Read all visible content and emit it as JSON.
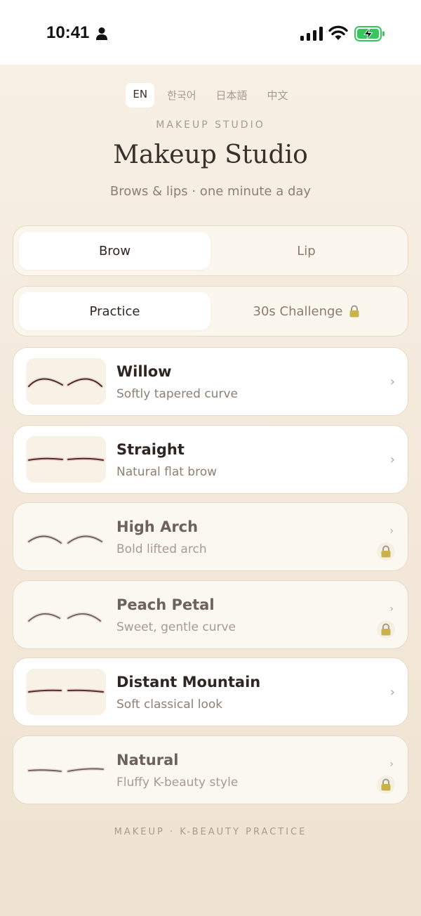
{
  "status_bar": {
    "time": "10:41"
  },
  "languages": [
    {
      "label": "EN",
      "active": true
    },
    {
      "label": "한국어",
      "active": false
    },
    {
      "label": "日本語",
      "active": false
    },
    {
      "label": "中文",
      "active": false
    }
  ],
  "header": {
    "eyebrow": "MAKEUP STUDIO",
    "title": "Makeup Studio",
    "subtitle": "Brows & lips · one minute a day"
  },
  "category_tabs": [
    {
      "label": "Brow",
      "active": true
    },
    {
      "label": "Lip",
      "active": false
    }
  ],
  "mode_tabs": [
    {
      "label": "Practice",
      "active": true,
      "locked": false
    },
    {
      "label": "30s Challenge",
      "active": false,
      "locked": true
    }
  ],
  "styles": [
    {
      "name": "Willow",
      "description": "Softly tapered curve",
      "locked": false,
      "shape": "willow"
    },
    {
      "name": "Straight",
      "description": "Natural flat brow",
      "locked": false,
      "shape": "straight"
    },
    {
      "name": "High Arch",
      "description": "Bold lifted arch",
      "locked": true,
      "shape": "arch"
    },
    {
      "name": "Peach Petal",
      "description": "Sweet, gentle curve",
      "locked": true,
      "shape": "petal"
    },
    {
      "name": "Distant Mountain",
      "description": "Soft classical look",
      "locked": false,
      "shape": "mountain"
    },
    {
      "name": "Natural",
      "description": "Fluffy K-beauty style",
      "locked": true,
      "shape": "natural"
    }
  ],
  "footer": "MAKEUP · K-BEAUTY PRACTICE",
  "colors": {
    "background": "#f5ecdf",
    "card": "#ffffff",
    "border": "#e7dac5",
    "text_primary": "#2f2622",
    "text_muted": "#8e7f72",
    "battery_green": "#34c759"
  }
}
